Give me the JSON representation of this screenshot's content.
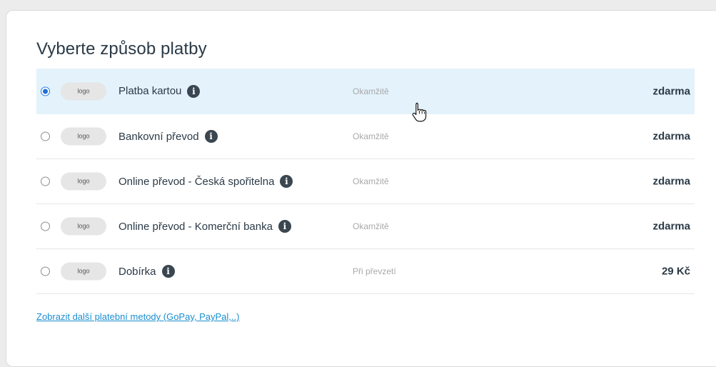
{
  "title": "Vyberte způsob platby",
  "methods": [
    {
      "logo": "logo",
      "name": "Platba kartou",
      "timing": "Okamžitě",
      "price": "zdarma",
      "selected": true
    },
    {
      "logo": "logo",
      "name": "Bankovní převod",
      "timing": "Okamžitě",
      "price": "zdarma",
      "selected": false
    },
    {
      "logo": "logo",
      "name": "Online převod - Česká spořitelna",
      "timing": "Okamžitě",
      "price": "zdarma",
      "selected": false
    },
    {
      "logo": "logo",
      "name": "Online převod - Komerční banka",
      "timing": "Okamžitě",
      "price": "zdarma",
      "selected": false
    },
    {
      "logo": "logo",
      "name": "Dobírka",
      "timing": "Při převzetí",
      "price": "29 Kč",
      "selected": false
    }
  ],
  "info_glyph": "i",
  "more_link": "Zobrazit další platební metody (GoPay, PayPal,..)",
  "colors": {
    "selected_row": "#e3f2fb",
    "link": "#1b8ed1",
    "text": "#2b3a47",
    "muted": "#a9a9a9"
  },
  "icons": {
    "info": "info-icon",
    "cursor": "hand-pointer-icon"
  }
}
